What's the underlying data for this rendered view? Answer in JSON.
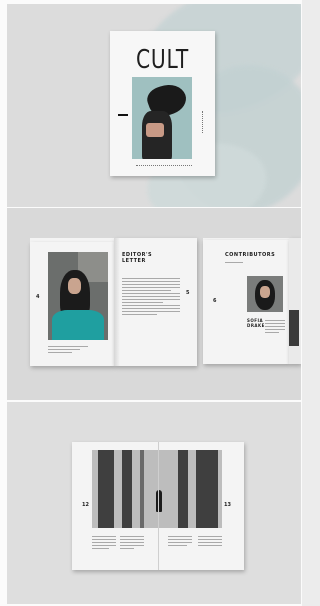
{
  "cover": {
    "title": "CULT"
  },
  "spread_editors": {
    "heading_line1": "EDITOR'S",
    "heading_line2": "LETTER",
    "page_left": "4",
    "page_right": "5"
  },
  "spread_contributors": {
    "heading": "CONTRIBUTORS",
    "page": "6",
    "name_line1": "SOFIA",
    "name_line2": "DRAKE"
  },
  "spread_street": {
    "page_left": "12",
    "page_right": "13"
  }
}
